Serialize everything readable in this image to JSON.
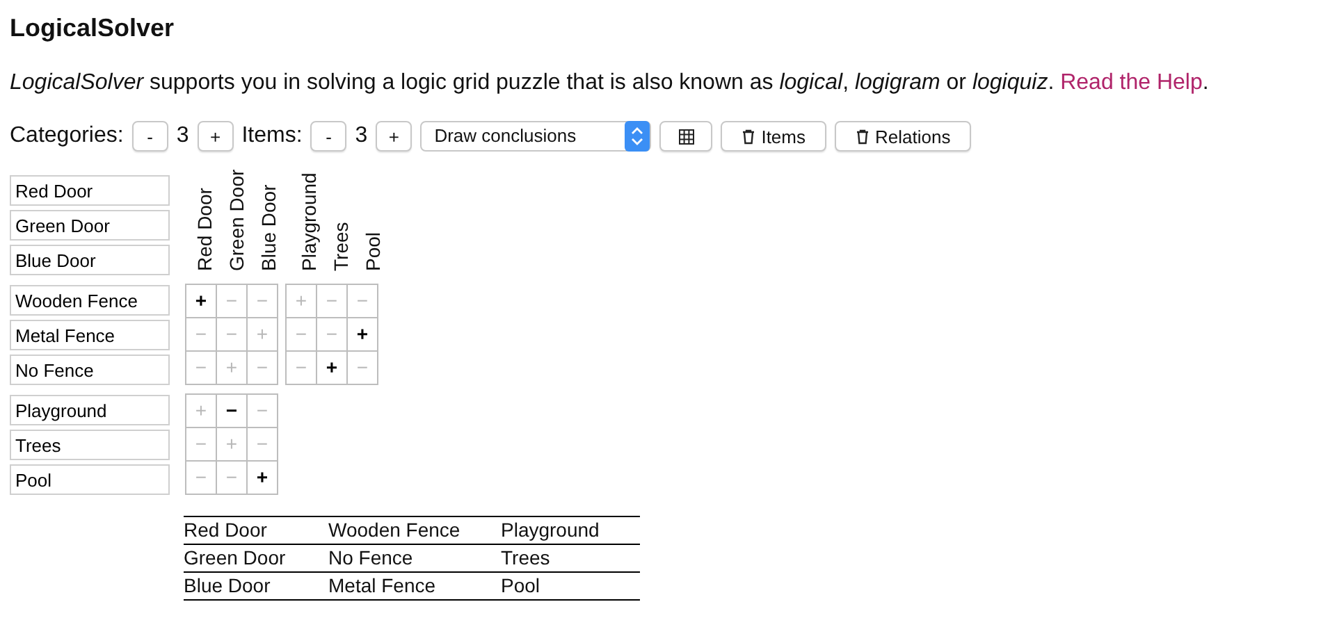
{
  "title": "LogicalSolver",
  "intro": "*LogicalSolver* supports you in solving a logic grid puzzle that is also known as *logical*, *logigram* or *logiquiz*. ",
  "help_link": "Read the Help",
  "intro_end": ".",
  "toolbar": {
    "categories_label": "Categories:",
    "categories_minus": "-",
    "categories_value": "3",
    "categories_plus": "+",
    "items_label": "Items:",
    "items_minus": "-",
    "items_value": "3",
    "items_plus": "+",
    "mode": "Draw conclusions",
    "clear_items": "Items",
    "clear_relations": "Relations"
  },
  "item_lists": [
    [
      "Red Door",
      "Green Door",
      "Blue Door"
    ],
    [
      "Wooden Fence",
      "Metal Fence",
      "No Fence"
    ],
    [
      "Playground",
      "Trees",
      "Pool"
    ]
  ],
  "column_headers": [
    [
      "Red Door",
      "Green Door",
      "Blue Door"
    ],
    [
      "Playground",
      "Trees",
      "Pool"
    ]
  ],
  "grid_groups": [
    {
      "blocks": [
        [
          [
            {
              "symbol": "+",
              "user_set": true
            },
            {
              "symbol": "−",
              "user_set": false
            },
            {
              "symbol": "−",
              "user_set": false
            }
          ],
          [
            {
              "symbol": "−",
              "user_set": false
            },
            {
              "symbol": "−",
              "user_set": false
            },
            {
              "symbol": "+",
              "user_set": false
            }
          ],
          [
            {
              "symbol": "−",
              "user_set": false
            },
            {
              "symbol": "+",
              "user_set": false
            },
            {
              "symbol": "−",
              "user_set": false
            }
          ]
        ],
        [
          [
            {
              "symbol": "+",
              "user_set": false
            },
            {
              "symbol": "−",
              "user_set": false
            },
            {
              "symbol": "−",
              "user_set": false
            }
          ],
          [
            {
              "symbol": "−",
              "user_set": false
            },
            {
              "symbol": "−",
              "user_set": false
            },
            {
              "symbol": "+",
              "user_set": true
            }
          ],
          [
            {
              "symbol": "−",
              "user_set": false
            },
            {
              "symbol": "+",
              "user_set": true
            },
            {
              "symbol": "−",
              "user_set": false
            }
          ]
        ]
      ]
    },
    {
      "blocks": [
        [
          [
            {
              "symbol": "+",
              "user_set": false
            },
            {
              "symbol": "−",
              "user_set": true
            },
            {
              "symbol": "−",
              "user_set": false
            }
          ],
          [
            {
              "symbol": "−",
              "user_set": false
            },
            {
              "symbol": "+",
              "user_set": false
            },
            {
              "symbol": "−",
              "user_set": false
            }
          ],
          [
            {
              "symbol": "−",
              "user_set": false
            },
            {
              "symbol": "−",
              "user_set": false
            },
            {
              "symbol": "+",
              "user_set": true
            }
          ]
        ]
      ]
    }
  ],
  "solution": [
    [
      "Red Door",
      "Wooden Fence",
      "Playground"
    ],
    [
      "Green Door",
      "No Fence",
      "Trees"
    ],
    [
      "Blue Door",
      "Metal Fence",
      "Pool"
    ]
  ]
}
